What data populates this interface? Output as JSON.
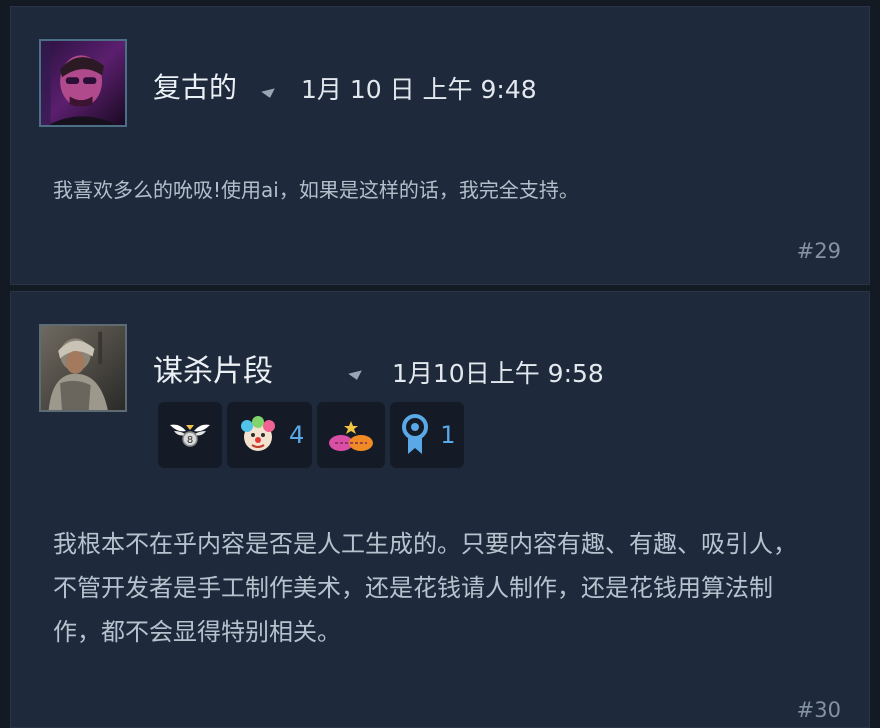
{
  "posts": [
    {
      "author": "复古的",
      "timestamp": "1月 10 日 上午 9:48",
      "body": "我喜欢多么的吮吸!使用ai，如果是这样的话，我完全支持。",
      "number": "#29"
    },
    {
      "author": "谋杀片段",
      "timestamp": "1月10日上午 9:58",
      "body": "我根本不在乎内容是否是人工生成的。只要内容有趣、有趣、吸引人，不管开发者是手工制作美术，还是花钱请人制作，还是花钱用算法制作，都不会显得特别相关。",
      "number": "#30",
      "awards": [
        {
          "icon": "winged-medal-icon",
          "count": ""
        },
        {
          "icon": "clown-face-icon",
          "count": "4"
        },
        {
          "icon": "heart-handshake-icon",
          "count": ""
        },
        {
          "icon": "ribbon-medal-icon",
          "count": "1"
        }
      ]
    }
  ],
  "colors": {
    "page_bg": "#141a24",
    "post_bg": "#1e2a3b",
    "award_count": "#5aa9e6"
  }
}
